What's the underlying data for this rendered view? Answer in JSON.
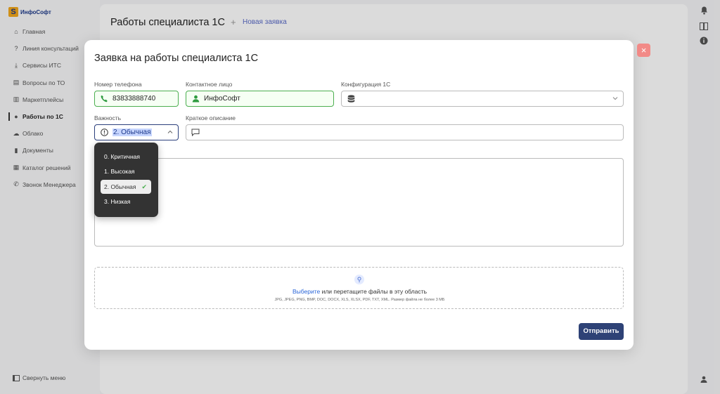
{
  "logo": {
    "mark": "S",
    "text": "ИнфоСофт"
  },
  "sidebar": {
    "items": [
      {
        "label": "Главная",
        "icon": "home-icon"
      },
      {
        "label": "Линия консультаций",
        "icon": "help-icon"
      },
      {
        "label": "Сервисы ИТС",
        "icon": "download-icon"
      },
      {
        "label": "Вопросы по ТО",
        "icon": "inbox-icon"
      },
      {
        "label": "Маркетплейсы",
        "icon": "store-icon"
      },
      {
        "label": "Работы по 1С",
        "icon": "user-gear-icon",
        "active": true
      },
      {
        "label": "Облако",
        "icon": "cloud-icon"
      },
      {
        "label": "Документы",
        "icon": "document-icon"
      },
      {
        "label": "Каталог решений",
        "icon": "grid-icon"
      },
      {
        "label": "Звонок Менеджера",
        "icon": "phone-icon"
      }
    ],
    "collapse_label": "Свернуть меню"
  },
  "header": {
    "title": "Работы специалиста 1С",
    "separator": "+",
    "new_request": "Новая заявка"
  },
  "modal": {
    "title": "Заявка на работы специалиста 1С",
    "close_icon": "×",
    "phone": {
      "label": "Номер телефона",
      "value": "83833888740"
    },
    "contact": {
      "label": "Контактное лицо",
      "value": "ИнфоСофт"
    },
    "config": {
      "label": "Конфигурация 1С",
      "value": ""
    },
    "priority": {
      "label": "Важность",
      "value": "2. Обычная"
    },
    "summary": {
      "label": "Краткое описание",
      "value": ""
    },
    "upload": {
      "link": "Выберите",
      "text": " или перетащите файлы в эту область",
      "hint": "JPG, JPEG, PNG, BMP, DOC, DOCX, XLS, XLSX, PDF, TXT, XML. Размер файла не более 3 МБ"
    },
    "submit_label": "Отправить"
  },
  "priority_options": [
    {
      "label": "0. Критичная"
    },
    {
      "label": "1. Высокая"
    },
    {
      "label": "2. Обычная",
      "selected": true
    },
    {
      "label": "3. Низкая"
    }
  ],
  "colors": {
    "accent": "#2e4276",
    "success": "#4caf50",
    "close": "#f28a87"
  }
}
